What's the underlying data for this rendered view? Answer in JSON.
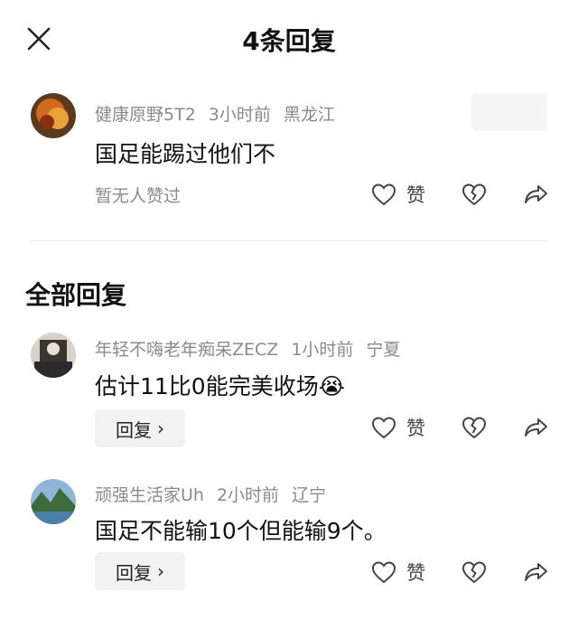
{
  "header": {
    "title": "4条回复"
  },
  "main_comment": {
    "username": "健康原野5T2",
    "time": "3小时前",
    "location": "黑龙江",
    "content": "国足能踢过他们不",
    "no_likes": "暂无人赞过",
    "like_label": "赞"
  },
  "section": {
    "title": "全部回复"
  },
  "replies": [
    {
      "username": "年轻不嗨老年痴呆ZECZ",
      "time": "1小时前",
      "location": "宁夏",
      "content": "估计11比0能完美收场",
      "emoji": "😭",
      "reply_label": "回复",
      "like_label": "赞"
    },
    {
      "username": "顽强生活家Uh",
      "time": "2小时前",
      "location": "辽宁",
      "content": "国足不能输10个但能输9个。",
      "reply_label": "回复",
      "like_label": "赞"
    }
  ],
  "colors": {
    "muted": "#8a8a8a",
    "text": "#111111",
    "button_bg": "#f2f2f2"
  },
  "icons": [
    "close-icon",
    "like-icon",
    "dislike-icon",
    "share-icon",
    "chevron-right-icon"
  ]
}
